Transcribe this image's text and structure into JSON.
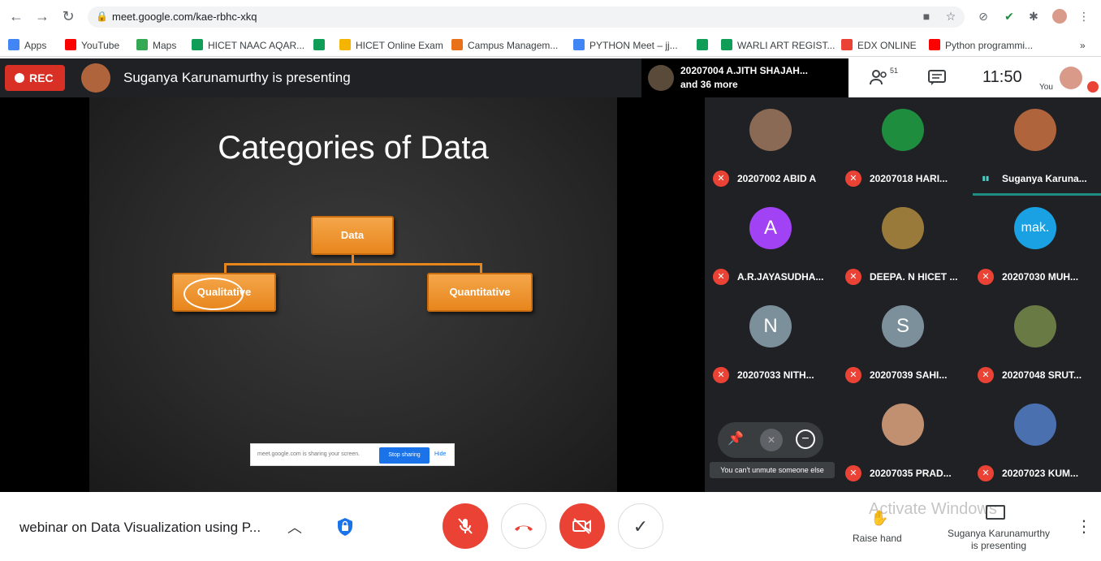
{
  "browser": {
    "url": "meet.google.com/kae-rbhc-xkq",
    "bookmarks": [
      {
        "label": "Apps",
        "color": "#4285f4"
      },
      {
        "label": "YouTube",
        "color": "#ff0000"
      },
      {
        "label": "Maps",
        "color": "#34a853"
      },
      {
        "label": "HICET NAAC AQAR...",
        "color": "#0f9d58"
      },
      {
        "label": "",
        "color": "#0f9d58"
      },
      {
        "label": "HICET Online Exam",
        "color": "#f4b400"
      },
      {
        "label": "Campus Managem...",
        "color": "#e8711a"
      },
      {
        "label": "PYTHON Meet – jj...",
        "color": "#4285f4"
      },
      {
        "label": "",
        "color": "#0f9d58"
      },
      {
        "label": "WARLI ART REGIST...",
        "color": "#0f9d58"
      },
      {
        "label": "EDX ONLINE",
        "color": "#ea4335"
      },
      {
        "label": "Python programmi...",
        "color": "#ff0000"
      }
    ],
    "more_bookmarks": "»"
  },
  "meet": {
    "rec_label": "REC",
    "presenter_text": "Suganya Karunamurthy is presenting",
    "joined_text_line1": "20207004 A.JITH SHAJAH...",
    "joined_text_line2": "and 36 more",
    "participants_count": "51",
    "clock": "11:50",
    "you_label": "You",
    "slide": {
      "title": "Categories of Data",
      "root": "Data",
      "left": "Qualitative",
      "right": "Quantitative"
    },
    "share_bar": {
      "text": "meet.google.com is sharing your screen.",
      "stop": "Stop sharing",
      "hide": "Hide"
    },
    "tiles": [
      {
        "name": "20207002 ABID A",
        "initial": "",
        "color": "#8a6a55"
      },
      {
        "name": "20207018 HARI...",
        "initial": "",
        "color": "#1e8e3e"
      },
      {
        "name": "Suganya Karuna...",
        "initial": "",
        "color": "#b0643c"
      },
      {
        "name": "A.R.JAYASUDHA...",
        "initial": "A",
        "color": "#a142f4"
      },
      {
        "name": "DEEPA. N HICET ...",
        "initial": "",
        "color": "#9a7a3a"
      },
      {
        "name": "20207030 MUH...",
        "initial": "mak.",
        "color": "#1aa1e3"
      },
      {
        "name": "20207033 NITH...",
        "initial": "N",
        "color": "#7c909c"
      },
      {
        "name": "20207039 SAHI...",
        "initial": "S",
        "color": "#7c909c"
      },
      {
        "name": "20207048 SRUT...",
        "initial": "",
        "color": "#6a7a44"
      },
      {
        "name": "",
        "initial": "",
        "color": "#202124"
      },
      {
        "name": "20207035 PRAD...",
        "initial": "",
        "color": "#c09070"
      },
      {
        "name": "20207023 KUM...",
        "initial": "",
        "color": "#4a70b0"
      }
    ],
    "tooltip": "You can't unmute someone else",
    "meeting_title": "webinar on Data Visualization using P...",
    "watermark": "Activate Windows",
    "raise_hand": "Raise hand",
    "presenting_line1": "Suganya Karunamurthy",
    "presenting_line2": "is presenting"
  },
  "colors": {
    "accent_red": "#ea4335",
    "rec_red": "#d93025",
    "orange": "#e8861e"
  }
}
